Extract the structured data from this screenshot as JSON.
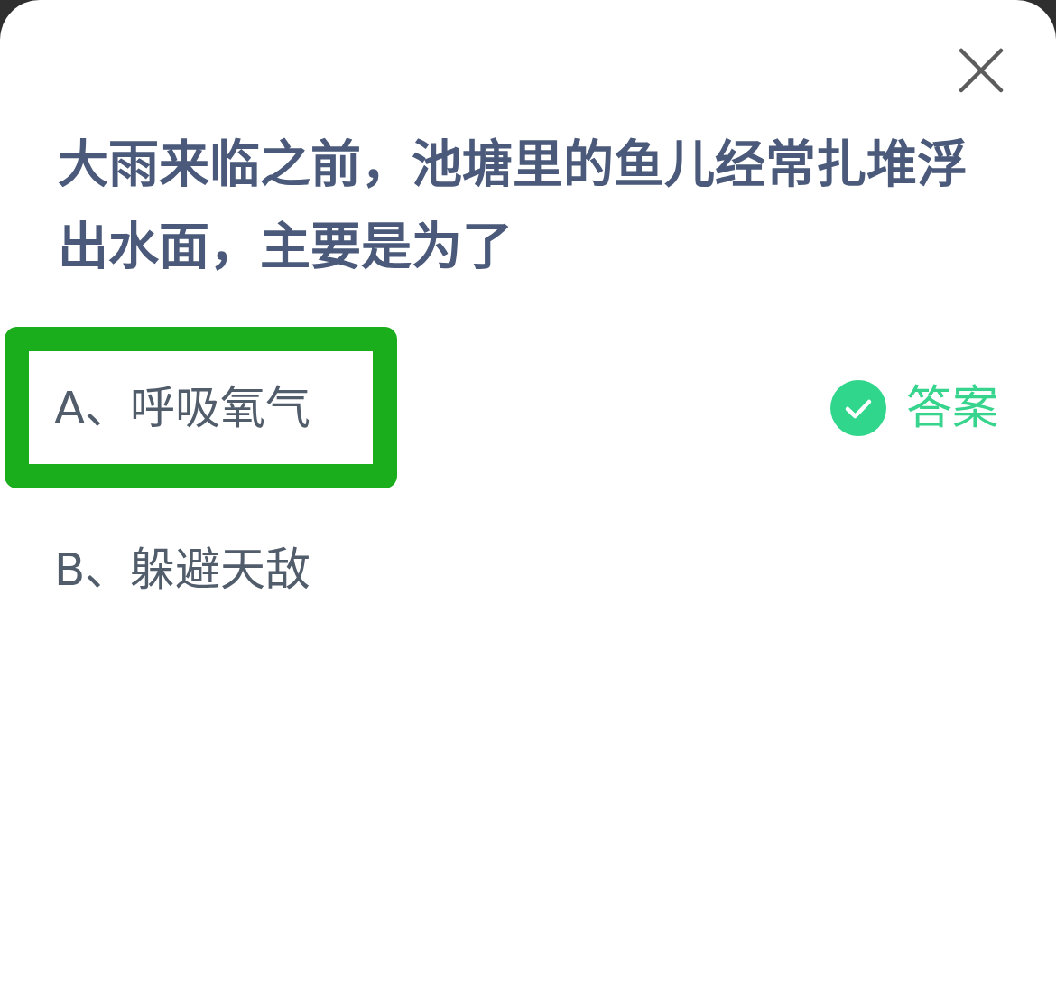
{
  "question": "大雨来临之前，池塘里的鱼儿经常扎堆浮出水面，主要是为了",
  "options": [
    {
      "text": "A、呼吸氧气",
      "selected": true,
      "badge": "答案"
    },
    {
      "text": "B、躲避天敌",
      "selected": false
    }
  ]
}
